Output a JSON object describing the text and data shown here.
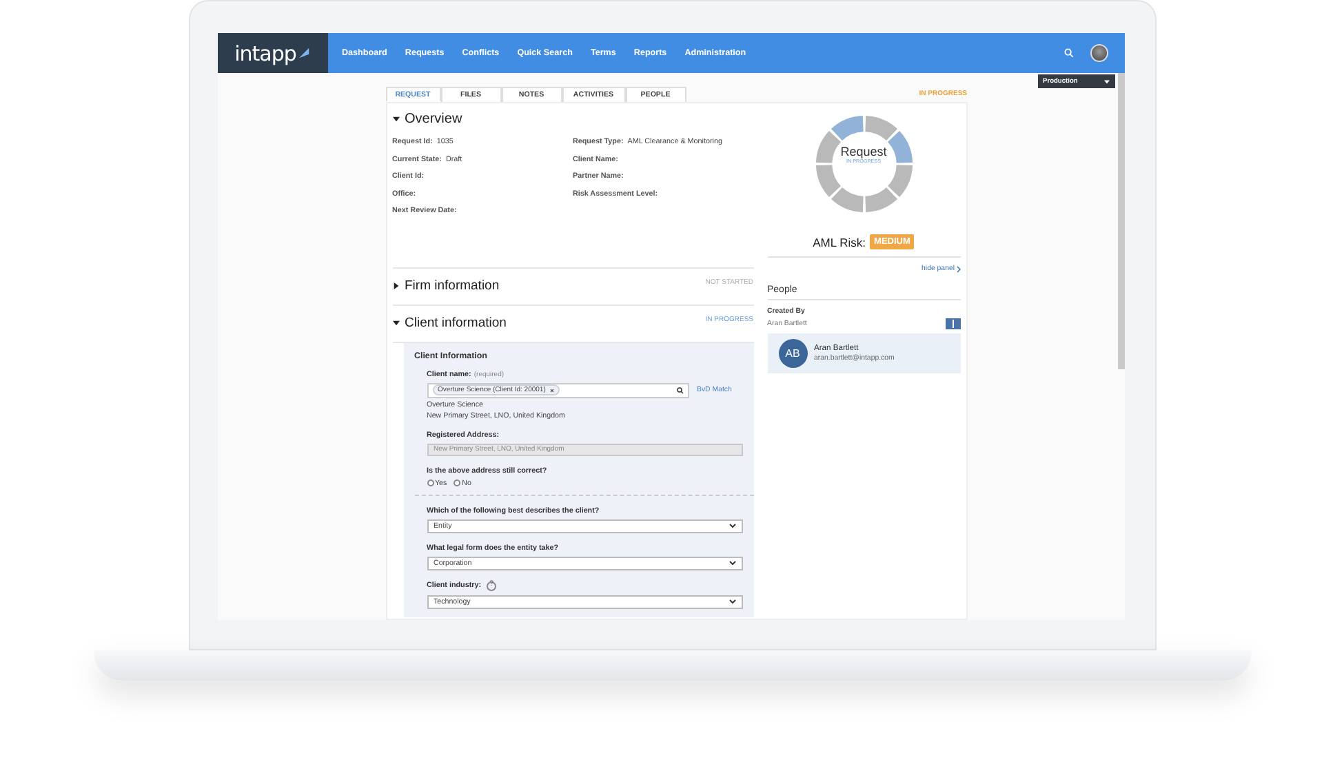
{
  "nav": {
    "logo": "intapp",
    "items": [
      "Dashboard",
      "Requests",
      "Conflicts",
      "Quick Search",
      "Terms",
      "Reports",
      "Administration"
    ],
    "environment": "Production"
  },
  "tabs": [
    {
      "label": "REQUEST",
      "selected": true
    },
    {
      "label": "FILES",
      "selected": false
    },
    {
      "label": "NOTES",
      "selected": false
    },
    {
      "label": "ACTIVITIES",
      "selected": false
    },
    {
      "label": "PEOPLE",
      "selected": false
    }
  ],
  "request_status": "IN PROGRESS",
  "overview": {
    "title": "Overview",
    "expanded": true,
    "left_fields": [
      {
        "label": "Request Id:",
        "value": "1035"
      },
      {
        "label": "Current State:",
        "value": "Draft"
      },
      {
        "label": "Client Id:"
      },
      {
        "label": "Office:"
      },
      {
        "label": "Next Review Date:"
      }
    ],
    "right_fields": [
      {
        "label": "Request Type:",
        "value": "AML Clearance & Monitoring"
      },
      {
        "label": "Client Name:"
      },
      {
        "label": "Partner Name:"
      },
      {
        "label": "Risk Assessment Level:"
      }
    ]
  },
  "progress": {
    "title": "Request",
    "subtitle": "IN PROGRESS",
    "segments": [
      {
        "complete": false
      },
      {
        "complete": true
      },
      {
        "complete": false
      },
      {
        "complete": false
      },
      {
        "complete": false
      },
      {
        "complete": false
      },
      {
        "complete": false
      },
      {
        "complete": true
      }
    ]
  },
  "aml_risk": {
    "label": "AML Risk:",
    "value": "MEDIUM"
  },
  "sections": [
    {
      "title": "Firm information",
      "expanded": false,
      "status": "NOT STARTED"
    },
    {
      "title": "Client information",
      "expanded": true,
      "status": "IN PROGRESS"
    }
  ],
  "client_form": {
    "heading": "Client Information",
    "client_name_label": "Client name:",
    "client_name_hint": "(required)",
    "client_token": "Overture Science (Client Id: 20001)",
    "match_link": "BvD Match",
    "client_address_lines": [
      "Overture Science",
      "New Primary Street, LNO, United Kingdom"
    ],
    "registered_address_label": "Registered Address:",
    "registered_address": "New Primary Street, LNO, United Kingdom",
    "address_question": "Is the above address still correct?",
    "address_options": [
      {
        "label": "Yes",
        "selected": false
      },
      {
        "label": "No",
        "selected": false
      }
    ],
    "selects": [
      {
        "label": "Which of the following best describes the client?",
        "value": "Entity"
      },
      {
        "label": "What legal form does the entity take?",
        "value": "Corporation"
      },
      {
        "label": "Client industry:",
        "value": "Technology",
        "help": "?"
      }
    ]
  },
  "side_panel": {
    "hide_label": "hide panel",
    "people_title": "People",
    "created_by_label": "Created By",
    "created_by": "Aran Bartlett",
    "person": {
      "initials": "AB",
      "name": "Aran Bartlett",
      "email": "aran.bartlett@intapp.com"
    }
  }
}
